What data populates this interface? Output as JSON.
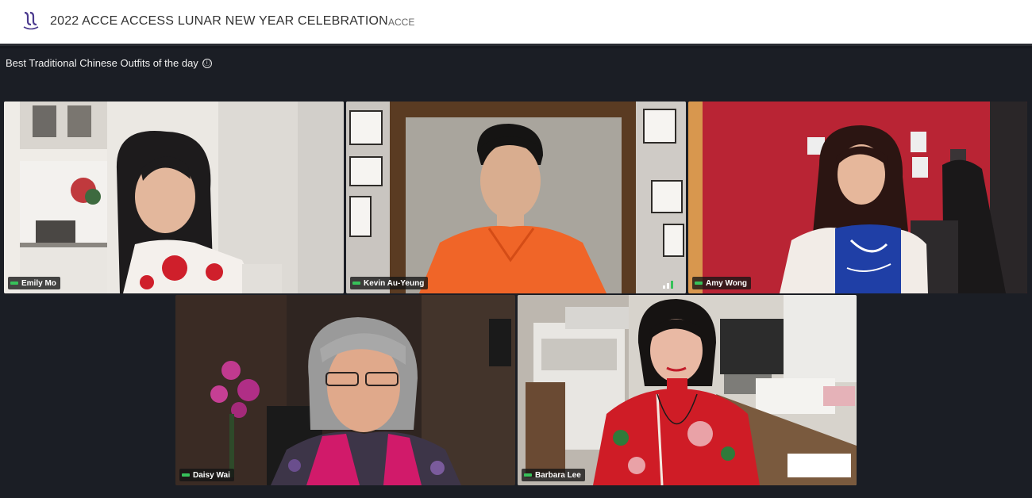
{
  "header": {
    "title": "2022 ACCE ACCESS LUNAR NEW YEAR CELEBRATION",
    "org": "ACCE",
    "logo_icon": "acce-logo-icon"
  },
  "section": {
    "title": "Best Traditional Chinese Outfits of the day",
    "info_icon": "ⓘ"
  },
  "participants": [
    {
      "name": "Emily Mo",
      "mic": "on"
    },
    {
      "name": "Kevin Au-Yeung",
      "mic": "on"
    },
    {
      "name": "Amy Wong",
      "mic": "on"
    },
    {
      "name": "Daisy Wai",
      "mic": "on"
    },
    {
      "name": "Barbara Lee",
      "mic": "on"
    }
  ],
  "colors": {
    "accent": "#37c15a",
    "background": "#1b1e25",
    "header_bg": "#ffffff"
  }
}
